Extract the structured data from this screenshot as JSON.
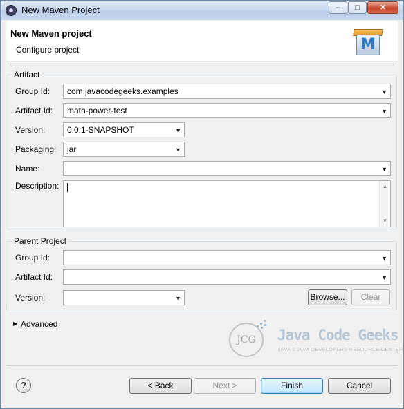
{
  "window": {
    "title": "New Maven Project"
  },
  "banner": {
    "title": "New Maven project",
    "subtitle": "Configure project",
    "logo_letter": "M"
  },
  "artifact": {
    "legend": "Artifact",
    "group_id_label": "Group Id:",
    "group_id_value": "com.javacodegeeks.examples",
    "artifact_id_label": "Artifact Id:",
    "artifact_id_value": "math-power-test",
    "version_label": "Version:",
    "version_value": "0.0.1-SNAPSHOT",
    "packaging_label": "Packaging:",
    "packaging_value": "jar",
    "name_label": "Name:",
    "name_value": "",
    "description_label": "Description:",
    "description_value": ""
  },
  "parent": {
    "legend": "Parent Project",
    "group_id_label": "Group Id:",
    "group_id_value": "",
    "artifact_id_label": "Artifact Id:",
    "artifact_id_value": "",
    "version_label": "Version:",
    "version_value": "",
    "browse_label": "Browse...",
    "clear_label": "Clear"
  },
  "advanced": {
    "label": "Advanced"
  },
  "watermark": {
    "title": "Java Code Geeks",
    "subtitle": "JAVA 2 JAVA DEVELOPERS RESOURCE CENTER",
    "badge": "JCG"
  },
  "footer": {
    "help": "?",
    "back_label": "< Back",
    "next_label": "Next >",
    "finish_label": "Finish",
    "cancel_label": "Cancel"
  },
  "icons": {
    "dropdown": "▼",
    "expand": "▶",
    "scroll_up": "▲",
    "scroll_down": "▼",
    "minimize": "‒",
    "maximize": "□",
    "close": "✕"
  },
  "colors": {
    "default_button_border": "#3c7fb1",
    "close_button": "#c7452a",
    "maven_blue": "#2a78c8"
  }
}
